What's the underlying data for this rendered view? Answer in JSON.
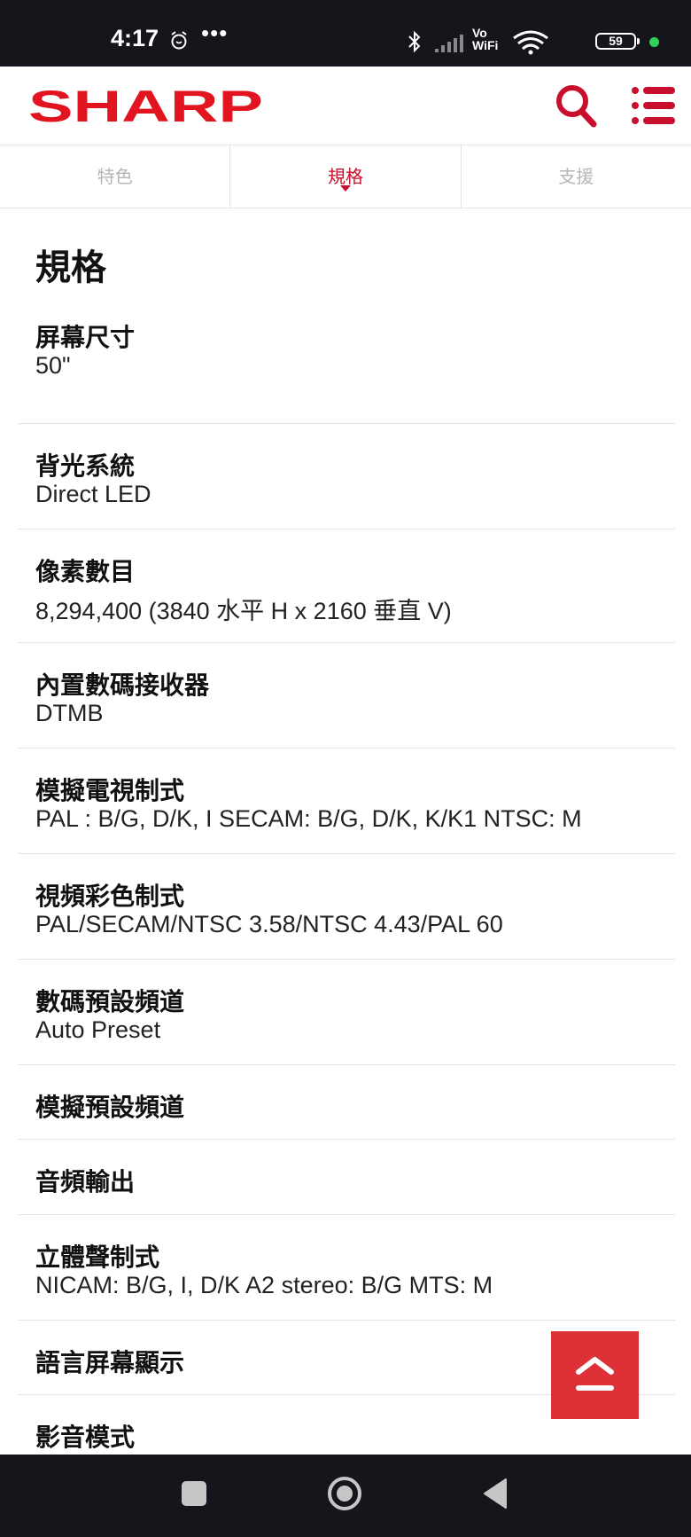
{
  "status_bar": {
    "time": "4:17",
    "dots": "•••",
    "vowifi_top": "Vo",
    "vowifi_bottom": "WiFi",
    "battery": "59"
  },
  "header": {
    "brand": "SHARP",
    "brand_color": "#e2141f",
    "accent_color": "#c8102e"
  },
  "tabs": [
    {
      "label": "特色"
    },
    {
      "label": "規格"
    },
    {
      "label": "支援"
    }
  ],
  "active_tab_index": 1,
  "section_title": "規格",
  "specs": [
    {
      "label": "屏幕尺寸",
      "value": "50\""
    },
    {
      "label": "背光系統",
      "value": "Direct LED"
    },
    {
      "label": "像素數目",
      "value": "8,294,400 (3840 水平 H x 2160 垂直 V)"
    },
    {
      "label": "內置數碼接收器",
      "value": "DTMB"
    },
    {
      "label": "模擬電視制式",
      "value": "PAL : B/G, D/K, I SECAM: B/G, D/K, K/K1 NTSC: M"
    },
    {
      "label": "視頻彩色制式",
      "value": "PAL/SECAM/NTSC 3.58/NTSC 4.43/PAL 60"
    },
    {
      "label": "數碼預設頻道",
      "value": "Auto Preset"
    },
    {
      "label": "模擬預設頻道",
      "value": ""
    },
    {
      "label": "音頻輸出",
      "value": ""
    },
    {
      "label": "立體聲制式",
      "value": "NICAM: B/G, I, D/K A2 stereo: B/G MTS: M"
    },
    {
      "label": "語言屏幕顯示",
      "value": ""
    },
    {
      "label": "影音模式",
      "value": ""
    }
  ]
}
